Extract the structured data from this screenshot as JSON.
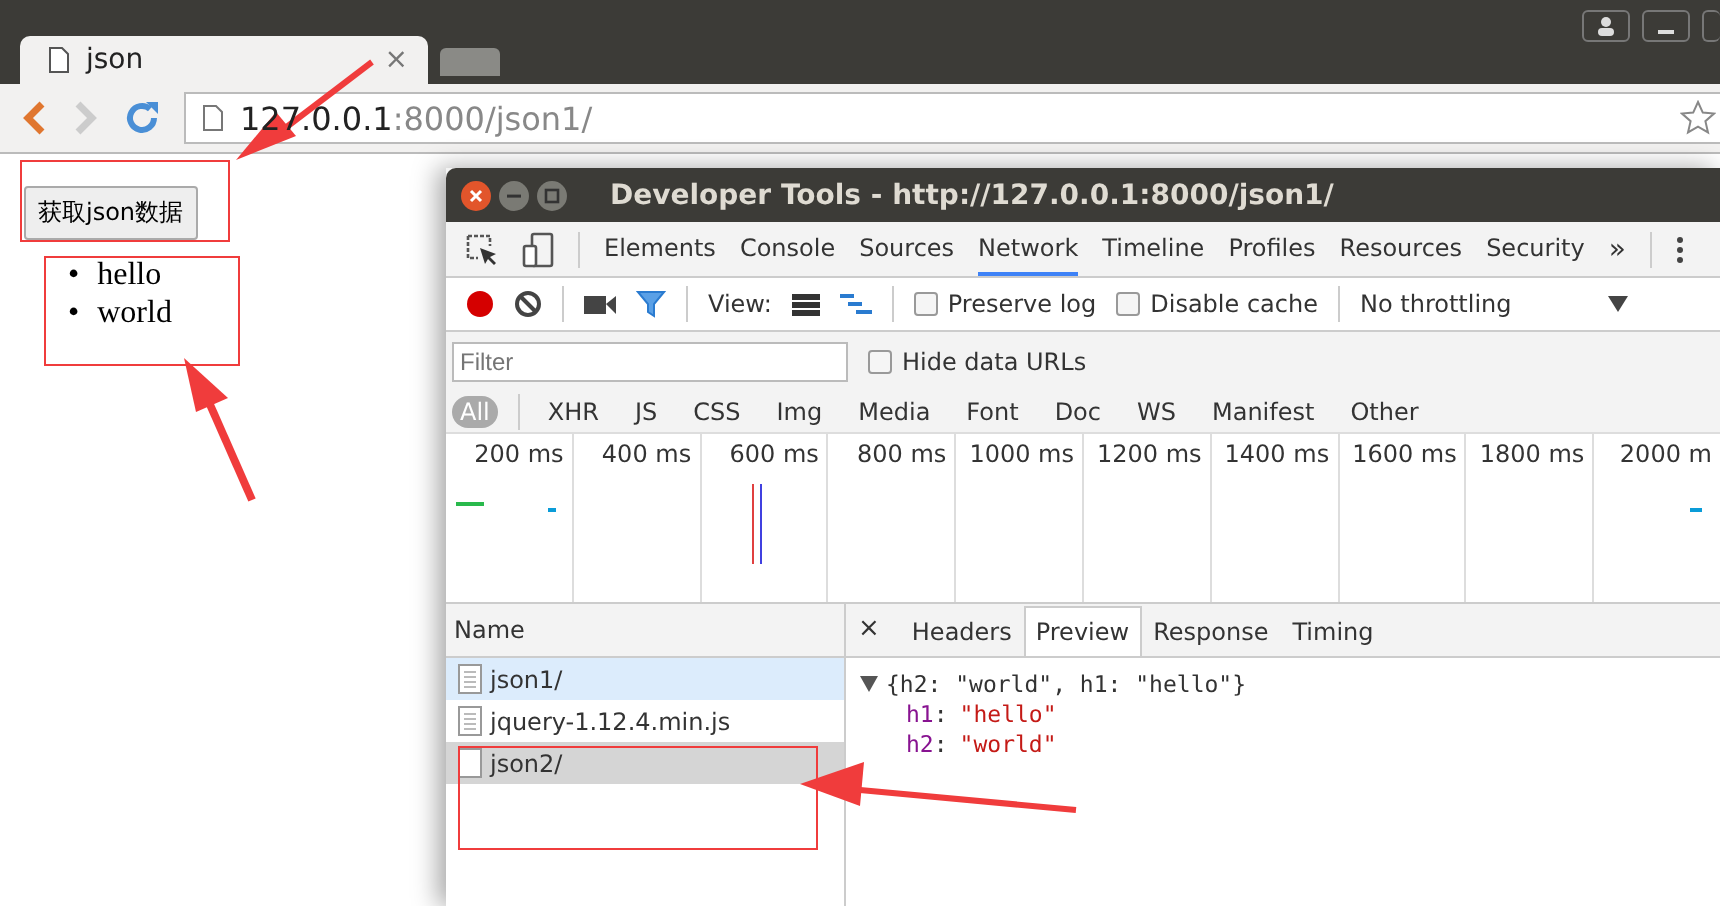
{
  "browser": {
    "tabs": [
      {
        "title": "json",
        "close": "×",
        "selected": true
      },
      {
        "selected": false
      }
    ],
    "address": {
      "host": "127.0.0.1",
      "rest": ":8000/json1/"
    }
  },
  "page": {
    "button": "获取json数据",
    "list": [
      {
        "marker": "•",
        "text": "hello"
      },
      {
        "marker": "•",
        "text": "world"
      }
    ]
  },
  "devtools": {
    "title": "Developer Tools - http://127.0.0.1:8000/json1/",
    "panels": [
      {
        "label": "Elements",
        "selected": false
      },
      {
        "label": "Console",
        "selected": false
      },
      {
        "label": "Sources",
        "selected": false
      },
      {
        "label": "Network",
        "selected": true
      },
      {
        "label": "Timeline",
        "selected": false
      },
      {
        "label": "Profiles",
        "selected": false
      },
      {
        "label": "Resources",
        "selected": false
      },
      {
        "label": "Security",
        "selected": false
      }
    ],
    "more": "»",
    "toolbar": {
      "view_label": "View:",
      "preserve_log": {
        "label": "Preserve log",
        "checked": false
      },
      "disable_cache": {
        "label": "Disable cache",
        "checked": false
      },
      "throttling": "No throttling"
    },
    "filter": {
      "placeholder": "Filter",
      "hide_data_urls": {
        "label": "Hide data URLs",
        "checked": false
      }
    },
    "types": [
      {
        "label": "All",
        "selected": true
      },
      {
        "label": "XHR",
        "selected": false
      },
      {
        "label": "JS",
        "selected": false
      },
      {
        "label": "CSS",
        "selected": false
      },
      {
        "label": "Img",
        "selected": false
      },
      {
        "label": "Media",
        "selected": false
      },
      {
        "label": "Font",
        "selected": false
      },
      {
        "label": "Doc",
        "selected": false
      },
      {
        "label": "WS",
        "selected": false
      },
      {
        "label": "Manifest",
        "selected": false
      },
      {
        "label": "Other",
        "selected": false
      }
    ],
    "ticks": [
      "200 ms",
      "400 ms",
      "600 ms",
      "800 ms",
      "1000 ms",
      "1200 ms",
      "1400 ms",
      "1600 ms",
      "1800 ms",
      "2000 m"
    ],
    "name_header": "Name",
    "requests": [
      {
        "name": "json1/",
        "selected": true,
        "hovered": false
      },
      {
        "name": "jquery-1.12.4.min.js",
        "selected": false,
        "hovered": false
      },
      {
        "name": "json2/",
        "selected": false,
        "hovered": true
      }
    ],
    "detail_close": "×",
    "detail_tabs": [
      {
        "label": "Headers",
        "selected": false
      },
      {
        "label": "Preview",
        "selected": true
      },
      {
        "label": "Response",
        "selected": false
      },
      {
        "label": "Timing",
        "selected": false
      }
    ],
    "preview": {
      "summary": "{h2: \"world\", h1: \"hello\"}",
      "props": [
        {
          "key": "h1",
          "sep": ":",
          "value": "\"hello\""
        },
        {
          "key": "h2",
          "sep": ":",
          "value": "\"world\""
        }
      ]
    }
  }
}
